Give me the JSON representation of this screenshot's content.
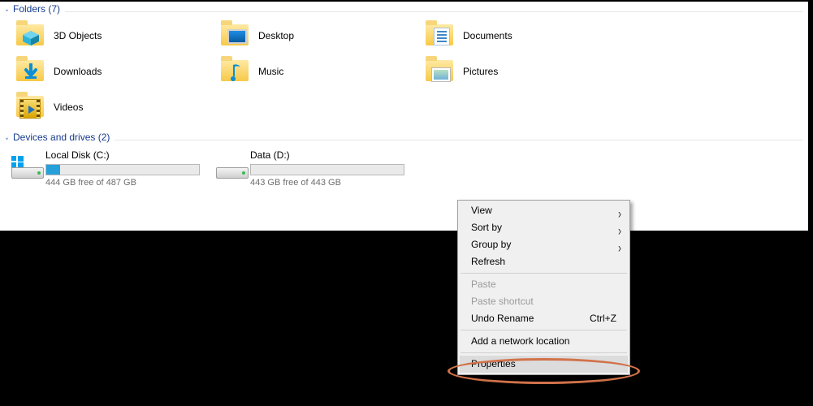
{
  "sections": {
    "folders": {
      "title": "Folders (7)"
    },
    "drives": {
      "title": "Devices and drives (2)"
    }
  },
  "folders": {
    "items": [
      {
        "name": "3D Objects",
        "icon": "3d-objects-icon"
      },
      {
        "name": "Desktop",
        "icon": "desktop-icon"
      },
      {
        "name": "Documents",
        "icon": "documents-icon"
      },
      {
        "name": "Downloads",
        "icon": "downloads-icon"
      },
      {
        "name": "Music",
        "icon": "music-icon"
      },
      {
        "name": "Pictures",
        "icon": "pictures-icon"
      },
      {
        "name": "Videos",
        "icon": "videos-icon"
      }
    ]
  },
  "drives": {
    "items": [
      {
        "name": "Local Disk (C:)",
        "sub": "444 GB free of 487 GB",
        "fill_pct": 9,
        "has_winlogo": true
      },
      {
        "name": "Data (D:)",
        "sub": "443 GB free of 443 GB",
        "fill_pct": 0,
        "has_winlogo": false
      }
    ]
  },
  "context_menu": {
    "items": [
      {
        "label": "View",
        "submenu": true,
        "enabled": true
      },
      {
        "label": "Sort by",
        "submenu": true,
        "enabled": true
      },
      {
        "label": "Group by",
        "submenu": true,
        "enabled": true
      },
      {
        "label": "Refresh",
        "submenu": false,
        "enabled": true
      },
      {
        "separator": true
      },
      {
        "label": "Paste",
        "submenu": false,
        "enabled": false
      },
      {
        "label": "Paste shortcut",
        "submenu": false,
        "enabled": false
      },
      {
        "label": "Undo Rename",
        "submenu": false,
        "enabled": true,
        "shortcut": "Ctrl+Z"
      },
      {
        "separator": true
      },
      {
        "label": "Add a network location",
        "submenu": false,
        "enabled": true
      },
      {
        "separator": true
      },
      {
        "label": "Properties",
        "submenu": false,
        "enabled": true,
        "highlighted": true
      }
    ]
  }
}
